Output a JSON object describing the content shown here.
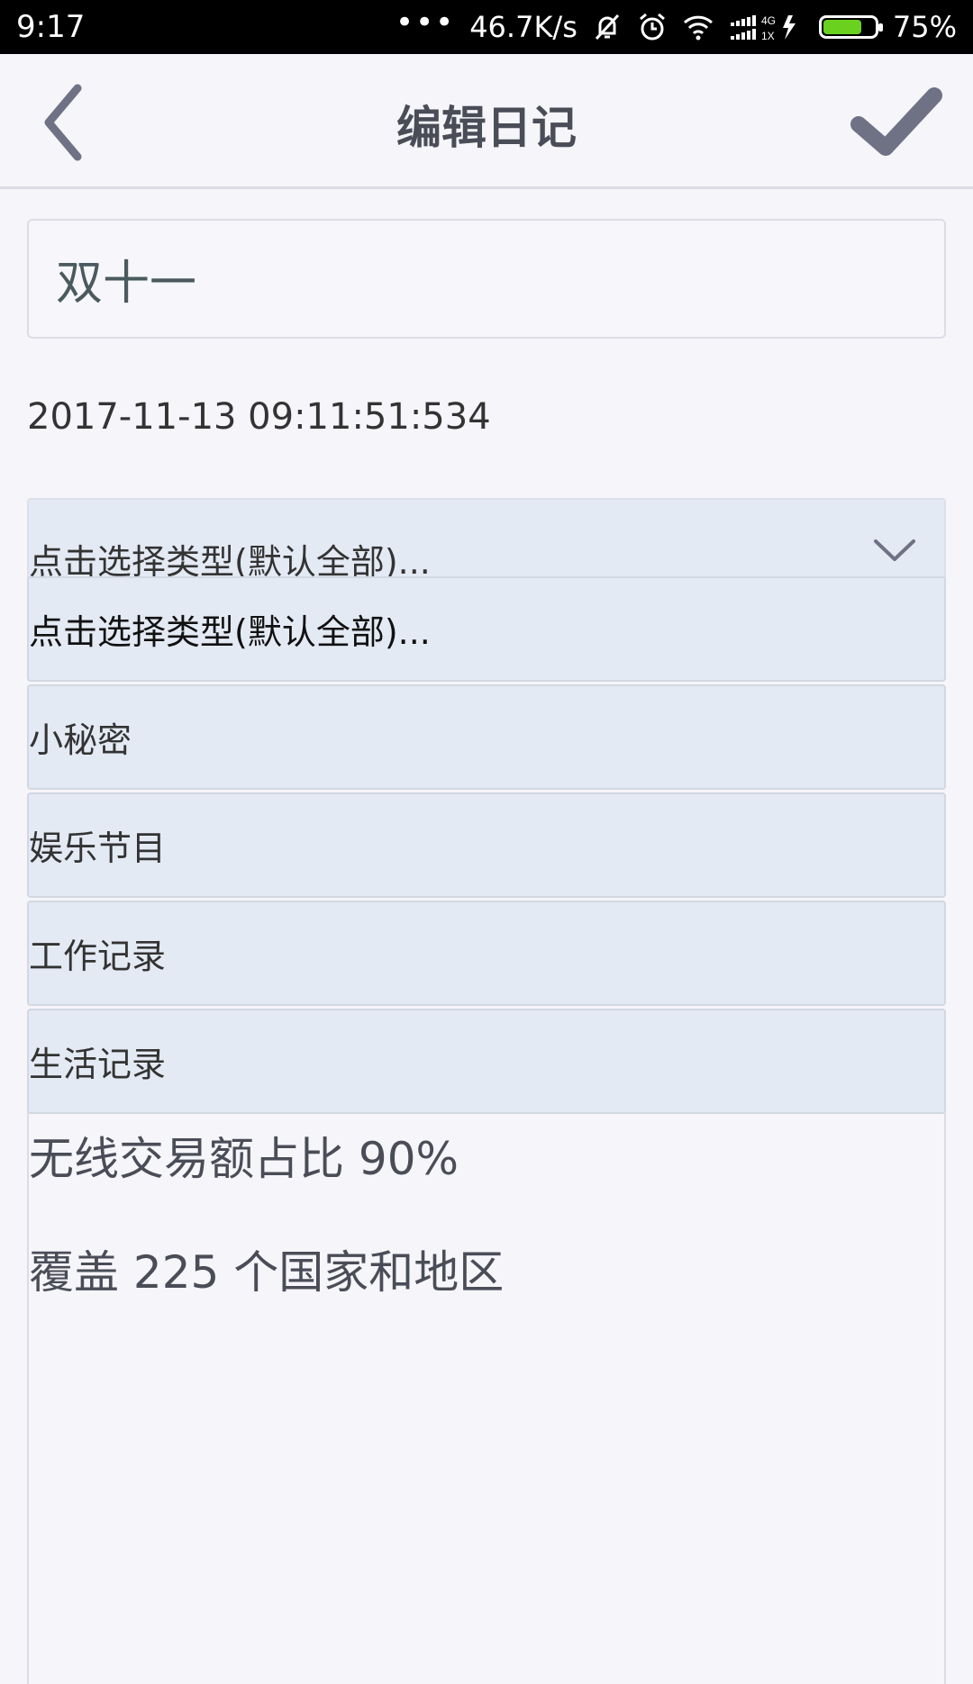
{
  "status_bar": {
    "time": "9:17",
    "dots": "•••",
    "net_speed": "46.7K/s",
    "signal_label_top": "4G",
    "signal_label_bottom": "1X",
    "battery_level": 0.75,
    "battery_text": "75%"
  },
  "header": {
    "title": "编辑日记"
  },
  "diary": {
    "title": "双十一",
    "datetime": "2017-11-13 09:11:51:534",
    "content_lines": [
      "无线交易额占比 90%",
      "覆盖 225 个国家和地区"
    ]
  },
  "type_select": {
    "selected": "点击选择类型(默认全部)...",
    "options": [
      "点击选择类型(默认全部)...",
      "小秘密",
      "娱乐节目",
      "工作记录",
      "生活记录"
    ]
  },
  "colors": {
    "accent": "#6f7285",
    "dropdown_bg": "#e4eaf4",
    "battery_green": "#6bd11f"
  }
}
